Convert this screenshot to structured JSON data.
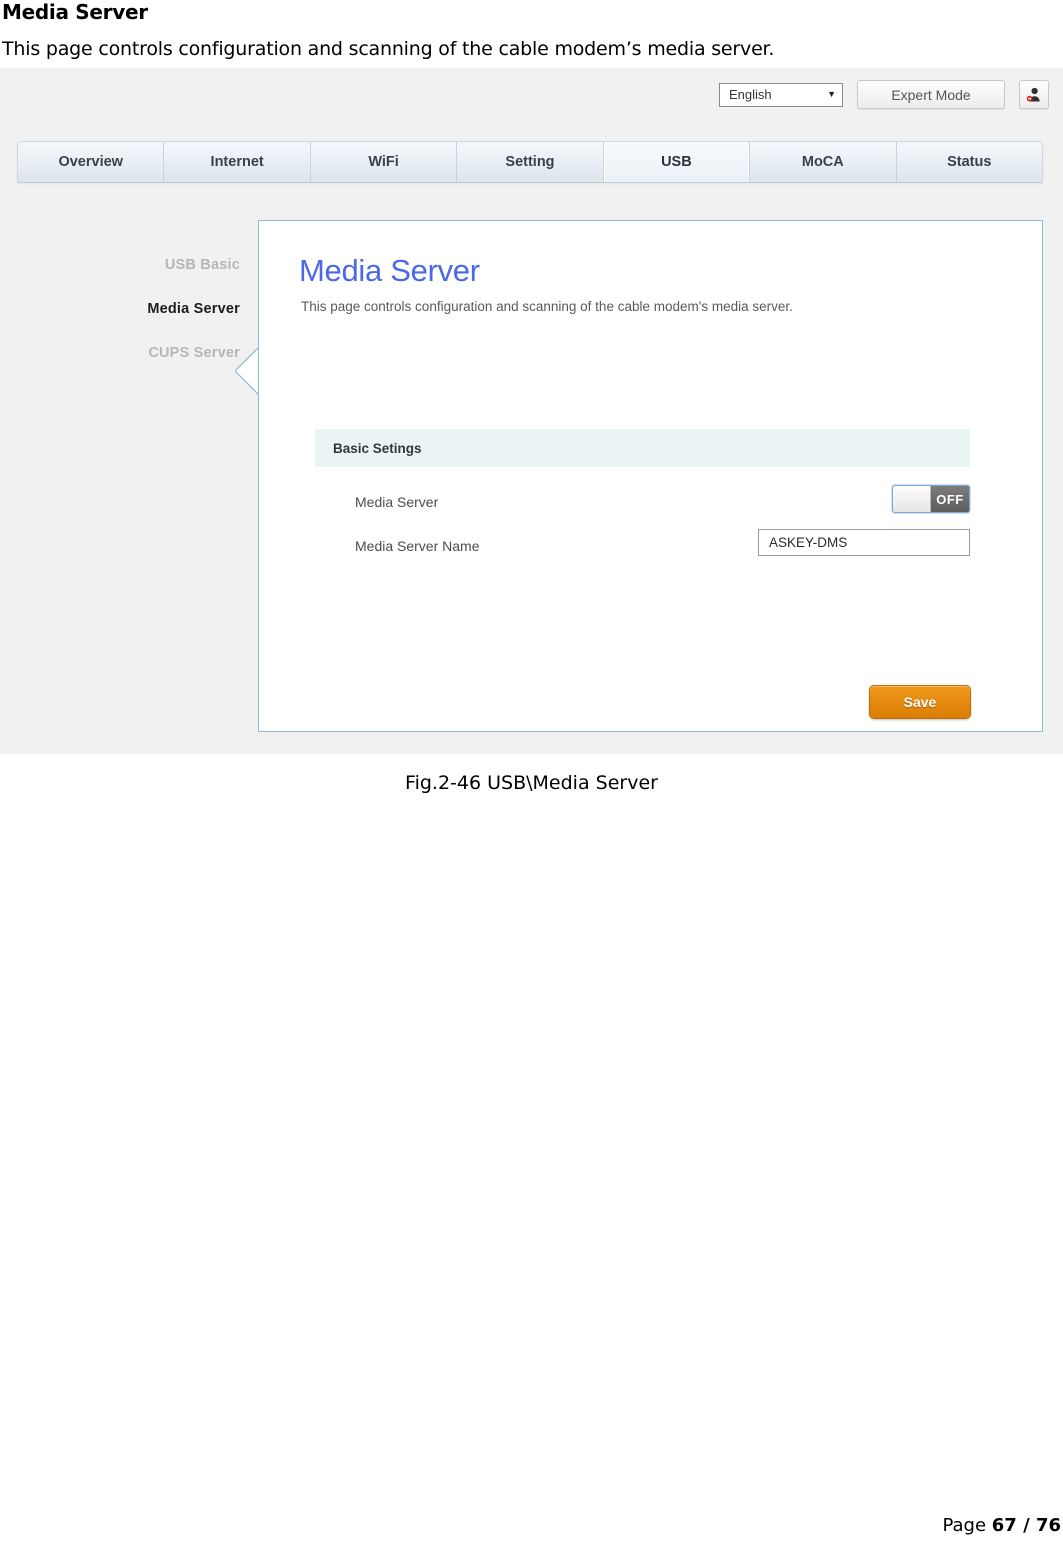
{
  "document": {
    "heading": "Media Server",
    "intro": "This page controls configuration and scanning of the cable modem’s media server.",
    "figure_caption": "Fig.2-46 USB\\Media Server",
    "footer_prefix": "Page ",
    "footer_page": "67 / 76"
  },
  "screenshot": {
    "topbar": {
      "language_value": "English",
      "language_caret": "▼",
      "expert_mode_label": "Expert Mode",
      "user_icon_name": "user-account-icon"
    },
    "tabs": [
      {
        "label": "Overview",
        "active": false
      },
      {
        "label": "Internet",
        "active": false
      },
      {
        "label": "WiFi",
        "active": false
      },
      {
        "label": "Setting",
        "active": false
      },
      {
        "label": "USB",
        "active": true
      },
      {
        "label": "MoCA",
        "active": false
      },
      {
        "label": "Status",
        "active": false
      }
    ],
    "sidenav": [
      {
        "label": "USB Basic",
        "active": false
      },
      {
        "label": "Media Server",
        "active": true
      },
      {
        "label": "CUPS Server",
        "active": false
      }
    ],
    "panel": {
      "title": "Media Server",
      "description": "This page controls configuration and scanning of the cable modem's media server.",
      "section_title": "Basic Setings",
      "rows": [
        {
          "label": "Media Server",
          "control": "toggle",
          "value": "OFF"
        },
        {
          "label": "Media Server Name",
          "control": "text",
          "value": "ASKEY-DMS"
        }
      ],
      "save_label": "Save"
    },
    "colors": {
      "panel_border": "#8fbad4",
      "panel_title": "#4a68e8",
      "section_header_bg": "#eaf4f4",
      "save_button": "#e8860c",
      "toggle_off_track": "#6d6d6d",
      "screenshot_bg": "#f1f1f1"
    }
  }
}
